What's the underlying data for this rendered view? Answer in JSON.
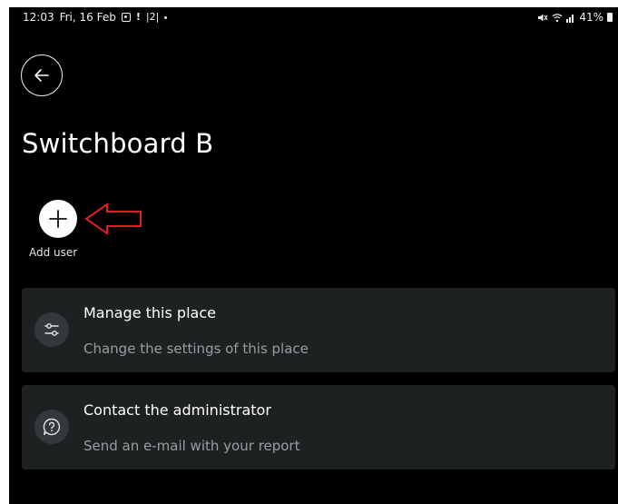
{
  "status_bar": {
    "time": "12:03",
    "date": "Fri, 16 Feb",
    "notif_exclaim": "!",
    "notif_box": "|2|",
    "battery": "41%"
  },
  "header": {
    "title": "Switchboard B"
  },
  "add_user": {
    "label": "Add user"
  },
  "cards": [
    {
      "title": "Manage this place",
      "subtitle": "Change the settings of this place",
      "icon": "sliders-icon"
    },
    {
      "title": "Contact the administrator",
      "subtitle": "Send an e-mail with your report",
      "icon": "question-bubble-icon"
    }
  ],
  "colors": {
    "background": "#000000",
    "card": "#1e2122",
    "card_icon_bg": "#34383a",
    "subtitle": "#9a9ea0",
    "annotation_arrow": "#e02020"
  }
}
